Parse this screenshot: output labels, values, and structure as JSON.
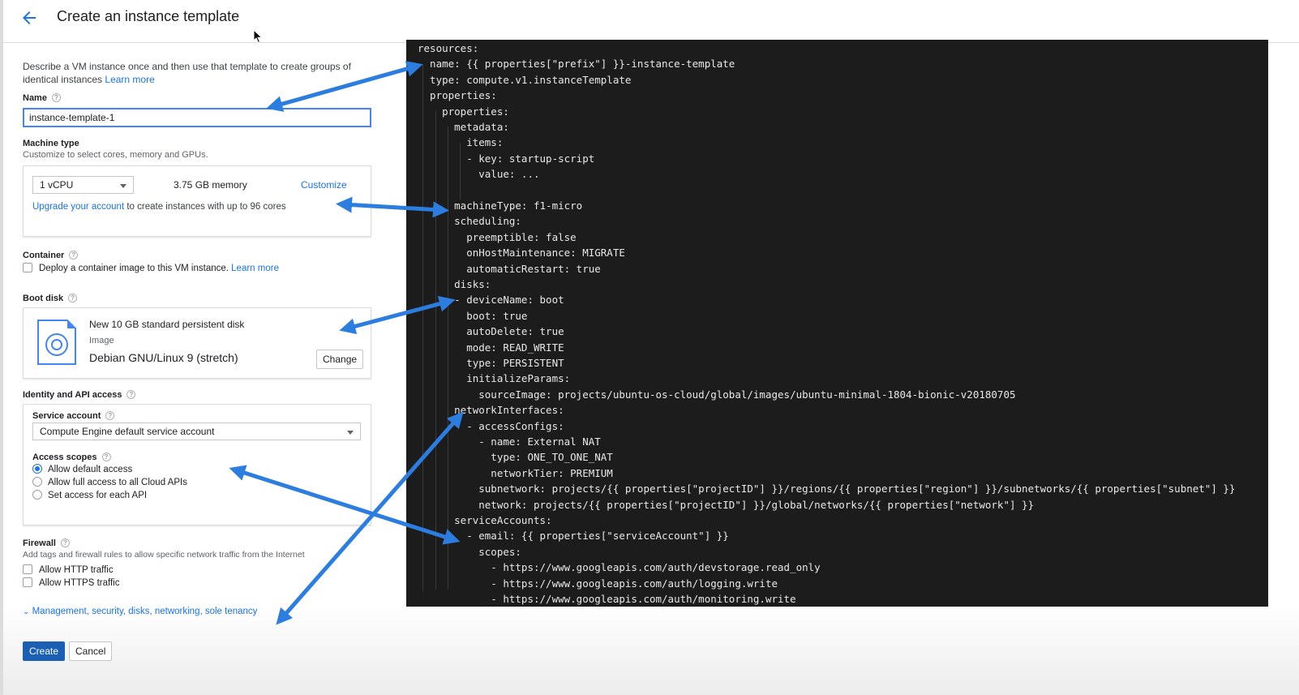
{
  "header": {
    "title": "Create an instance template"
  },
  "form": {
    "description": "Describe a VM instance once and then use that template to create groups of identical instances",
    "description_link": "Learn more",
    "name": {
      "label": "Name",
      "value": "instance-template-1"
    },
    "machine_type": {
      "label": "Machine type",
      "hint": "Customize to select cores, memory and GPUs.",
      "cpu": "1 vCPU",
      "memory": "3.75 GB memory",
      "customize": "Customize",
      "upgrade_link": "Upgrade your account",
      "upgrade_text": " to create instances with up to 96 cores"
    },
    "container": {
      "label": "Container",
      "checkbox_text": "Deploy a container image to this VM instance.",
      "link": "Learn more"
    },
    "boot_disk": {
      "label": "Boot disk",
      "title": "New 10 GB standard persistent disk",
      "image_label": "Image",
      "image_value": "Debian GNU/Linux 9 (stretch)",
      "change": "Change"
    },
    "identity": {
      "label": "Identity and API access",
      "service_account_label": "Service account",
      "service_account_value": "Compute Engine default service account",
      "scopes_label": "Access scopes",
      "scopes": [
        {
          "label": "Allow default access",
          "selected": true
        },
        {
          "label": "Allow full access to all Cloud APIs",
          "selected": false
        },
        {
          "label": "Set access for each API",
          "selected": false
        }
      ]
    },
    "firewall": {
      "label": "Firewall",
      "hint": "Add tags and firewall rules to allow specific network traffic from the Internet",
      "http": "Allow HTTP traffic",
      "https": "Allow HTTPS traffic"
    },
    "more_link": "Management, security, disks, networking, sole tenancy",
    "create": "Create",
    "cancel": "Cancel"
  },
  "code": {
    "lines": [
      "resources:",
      "- name: {{ properties[\"prefix\"] }}-instance-template",
      "  type: compute.v1.instanceTemplate",
      "  properties:",
      "    properties:",
      "      metadata:",
      "        items:",
      "        - key: startup-script",
      "          value: ...",
      "",
      "      machineType: f1-micro",
      "      scheduling:",
      "        preemptible: false",
      "        onHostMaintenance: MIGRATE",
      "        automaticRestart: true",
      "      disks:",
      "      - deviceName: boot",
      "        boot: true",
      "        autoDelete: true",
      "        mode: READ_WRITE",
      "        type: PERSISTENT",
      "        initializeParams:",
      "          sourceImage: projects/ubuntu-os-cloud/global/images/ubuntu-minimal-1804-bionic-v20180705",
      "      networkInterfaces:",
      "        - accessConfigs:",
      "          - name: External NAT",
      "            type: ONE_TO_ONE_NAT",
      "            networkTier: PREMIUM",
      "          subnetwork: projects/{{ properties[\"projectID\"] }}/regions/{{ properties[\"region\"] }}/subnetworks/{{ properties[\"subnet\"] }}",
      "          network: projects/{{ properties[\"projectID\"] }}/global/networks/{{ properties[\"network\"] }}",
      "      serviceAccounts:",
      "        - email: {{ properties[\"serviceAccount\"] }}",
      "          scopes:",
      "            - https://www.googleapis.com/auth/devstorage.read_only",
      "            - https://www.googleapis.com/auth/logging.write",
      "            - https://www.googleapis.com/auth/monitoring.write"
    ]
  },
  "colors": {
    "accent": "#1a73e8",
    "arrow": "#2b7de0",
    "code_background": "#1c1c1c"
  }
}
